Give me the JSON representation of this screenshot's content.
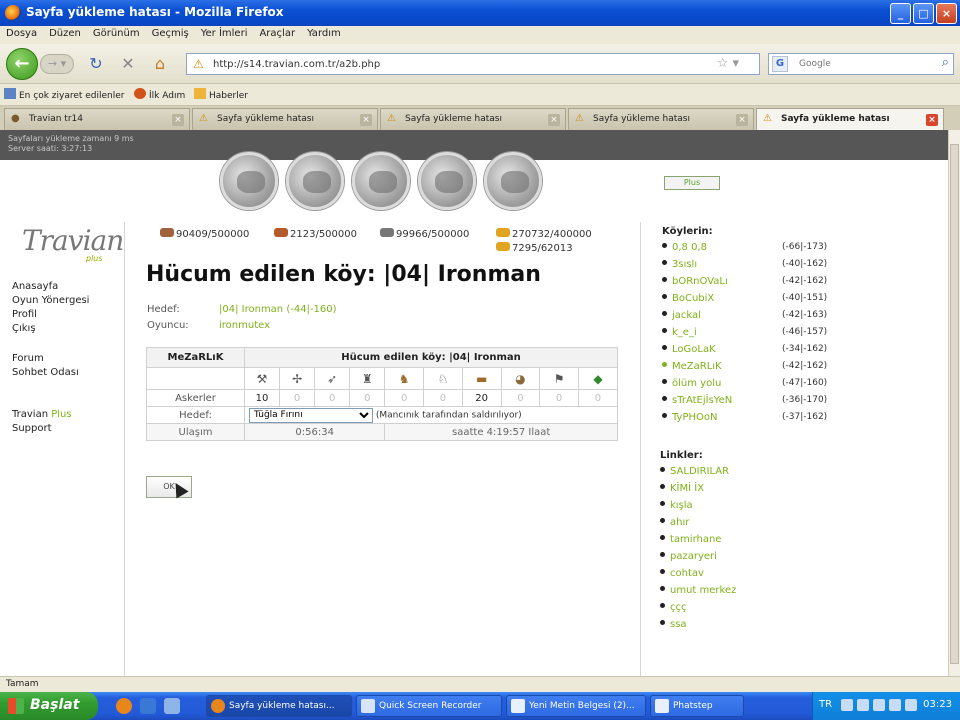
{
  "window": {
    "title": "Sayfa yükleme hatası - Mozilla Firefox",
    "controls": [
      "_",
      "□",
      "×"
    ]
  },
  "menu": [
    "Dosya",
    "Düzen",
    "Görünüm",
    "Geçmiş",
    "Yer İmleri",
    "Araçlar",
    "Yardım"
  ],
  "nav": {
    "url": "http://s14.travian.com.tr/a2b.php",
    "search_placeholder": "Google"
  },
  "bookmarks": [
    "En çok ziyaret edilenler",
    "İlk Adım",
    "Haberler"
  ],
  "tabs": [
    {
      "label": "Travian tr14",
      "active": false
    },
    {
      "label": "Sayfa yükleme hatası",
      "active": false
    },
    {
      "label": "Sayfa yükleme hatası",
      "active": false
    },
    {
      "label": "Sayfa yükleme hatası",
      "active": false
    },
    {
      "label": "Sayfa yükleme hatası",
      "active": true
    }
  ],
  "page_status": {
    "line1": "Sayfaları yükleme zamanı 9 ms",
    "line2": "Server saati: 3:27:13"
  },
  "plus_button": "Plus",
  "logo": {
    "main": "Travian",
    "sub": "plus"
  },
  "left_menu": {
    "group1": [
      "Anasayfa",
      "Oyun Yönergesi",
      "Profil",
      "Çıkış"
    ],
    "group2": [
      "Forum",
      "Sohbet Odası"
    ],
    "plus_prefix": "Travian",
    "plus_word": "Plus",
    "support": "Support"
  },
  "resources": {
    "wood": "90409/500000",
    "clay": "2123/500000",
    "iron": "99966/500000",
    "crop": "270732/400000",
    "consumption": "7295/62013"
  },
  "heading": "Hücum edilen köy: |04| Ironman",
  "target": {
    "hedef_label": "Hedef:",
    "hedef_value": "|04| Ironman (-44|-160)",
    "oyuncu_label": "Oyuncu:",
    "oyuncu_value": "ironmutex"
  },
  "troop_table": {
    "left_head": "MeZaRLıK",
    "right_head": "Hücum edilen köy: |04| Ironman",
    "units_icons": [
      "club",
      "spear",
      "axe",
      "scout",
      "paladin",
      "knight",
      "ram",
      "catapult",
      "chief",
      "settler"
    ],
    "askerler_label": "Askerler",
    "counts": [
      "10",
      "0",
      "0",
      "0",
      "0",
      "0",
      "20",
      "0",
      "0",
      "0"
    ],
    "hedef_label": "Hedef:",
    "select_value": "Tüğla Fırını",
    "select_note": "(Mancınık tarafından saldırılıyor)",
    "varis_label": "Ulaşım",
    "duration": "0:56:34",
    "arrival": "saatte 4:19:57 Ilaat"
  },
  "ok_button": "OK",
  "villages": {
    "title": "Köylerin:",
    "items": [
      {
        "name": "0,8 0,8",
        "coords": "(-66|-173)",
        "active": false
      },
      {
        "name": "3sıslı",
        "coords": "(-40|-162)",
        "active": false
      },
      {
        "name": "bORnOVaLı",
        "coords": "(-42|-162)",
        "active": false
      },
      {
        "name": "BoCubiX",
        "coords": "(-40|-151)",
        "active": false
      },
      {
        "name": "jackal",
        "coords": "(-42|-163)",
        "active": false
      },
      {
        "name": "k_e_i",
        "coords": "(-46|-157)",
        "active": false
      },
      {
        "name": "LoGoLaK",
        "coords": "(-34|-162)",
        "active": false
      },
      {
        "name": "MeZaRLıK",
        "coords": "(-42|-162)",
        "active": true
      },
      {
        "name": "ölüm yolu",
        "coords": "(-47|-160)",
        "active": false
      },
      {
        "name": "sTrAtEjİsYeN",
        "coords": "(-36|-170)",
        "active": false
      },
      {
        "name": "TyPHOoN",
        "coords": "(-37|-162)",
        "active": false
      }
    ]
  },
  "links": {
    "title": "Linkler:",
    "items": [
      "SALDIRILAR",
      "KİMİ İX",
      "kışla",
      "ahır",
      "tamirhane",
      "pazaryeri",
      "cohtav",
      "umut merkez",
      "ççç",
      "ssa"
    ]
  },
  "statusbar": "Tamam",
  "taskbar": {
    "start": "Başlat",
    "tasks": [
      {
        "label": "Sayfa yükleme hatası...",
        "active": true
      },
      {
        "label": "Quick Screen Recorder",
        "active": false
      },
      {
        "label": "Yeni Metin Belgesi (2)...",
        "active": false
      },
      {
        "label": "Phatstep",
        "active": false
      }
    ],
    "lang": "TR",
    "clock": "03:23"
  }
}
